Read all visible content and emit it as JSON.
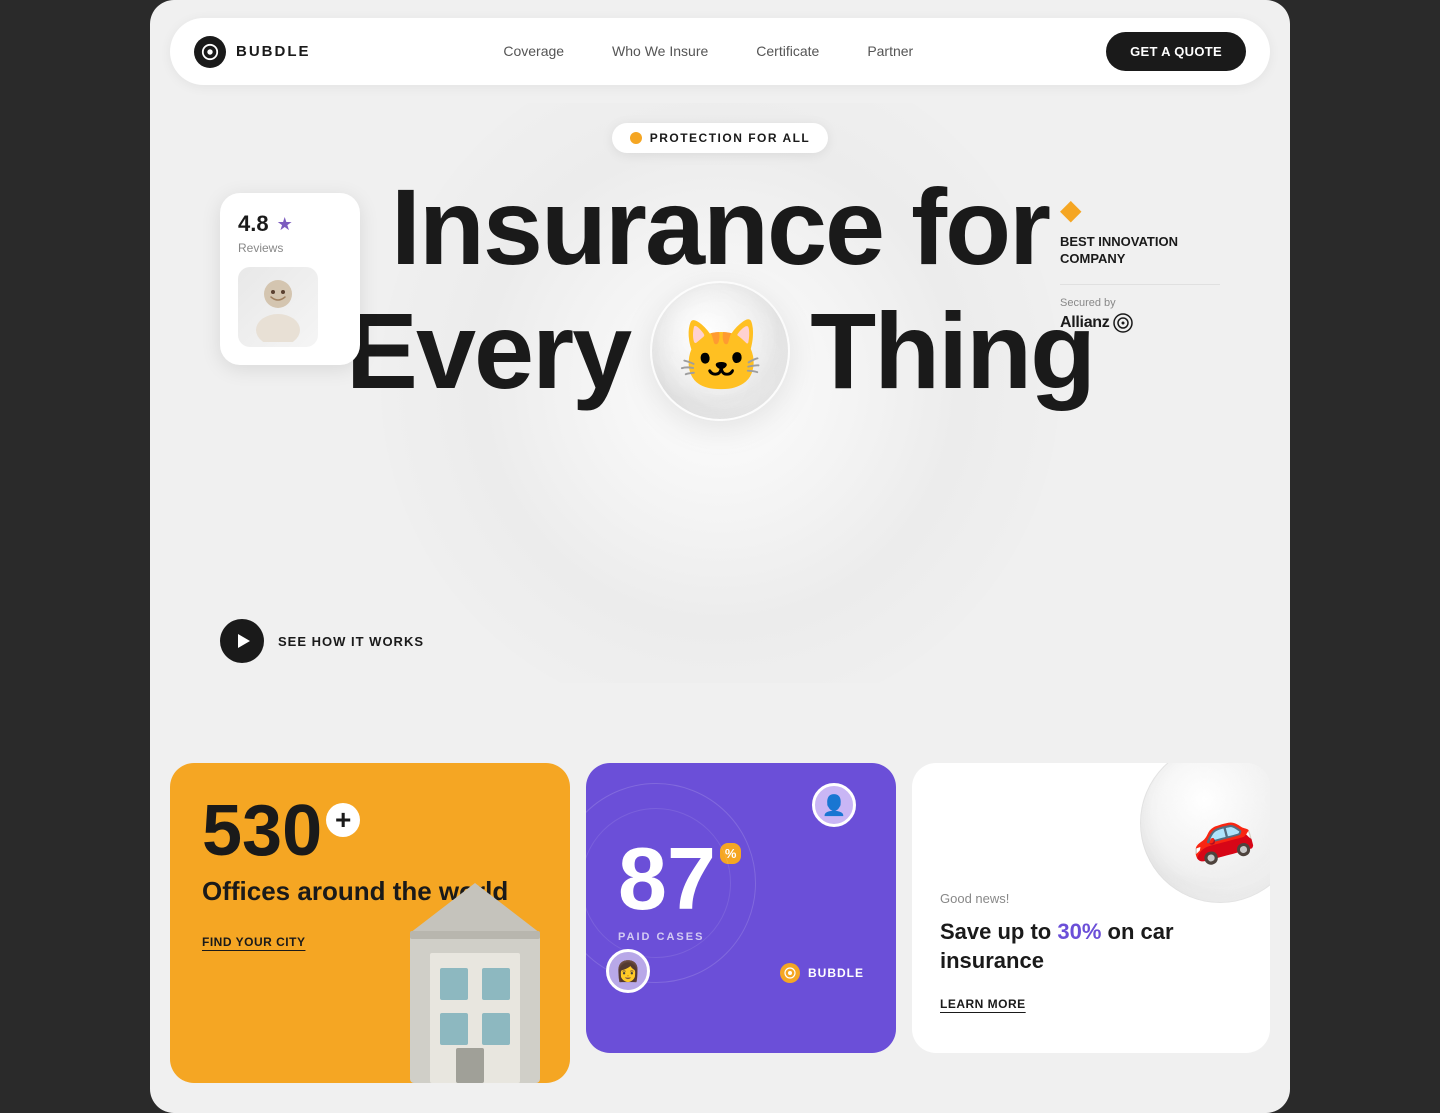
{
  "nav": {
    "logo_text": "BUBDLE",
    "links": [
      {
        "label": "Coverage",
        "id": "coverage"
      },
      {
        "label": "Who We Insure",
        "id": "who-we-insure"
      },
      {
        "label": "Certificate",
        "id": "certificate"
      },
      {
        "label": "Partner",
        "id": "partner"
      }
    ],
    "cta_label": "GET A QUOTE"
  },
  "hero": {
    "badge_text": "PROTECTION FOR ALL",
    "title_line1": "Insurance for",
    "title_line2_before": "Every",
    "title_line2_after": "Thing"
  },
  "review_card": {
    "rating": "4.8",
    "label": "Reviews"
  },
  "innovation_card": {
    "title": "BEST INNOVATION COMPANY",
    "secured_label": "Secured by",
    "brand": "Allianz"
  },
  "how_it_works": {
    "label": "SEE HOW IT WORKS"
  },
  "offices_card": {
    "number": "530",
    "plus": "+",
    "description": "Offices around the world",
    "link": "FIND YOUR CITY"
  },
  "paid_cases_card": {
    "number": "87",
    "percent": "%",
    "label": "PAID CASES",
    "brand": "BUBDLE"
  },
  "save_card": {
    "good_news": "Good news!",
    "title_before": "Save up to",
    "percent": "30%",
    "title_after": "on car insurance",
    "cta": "LEARN MORE"
  }
}
